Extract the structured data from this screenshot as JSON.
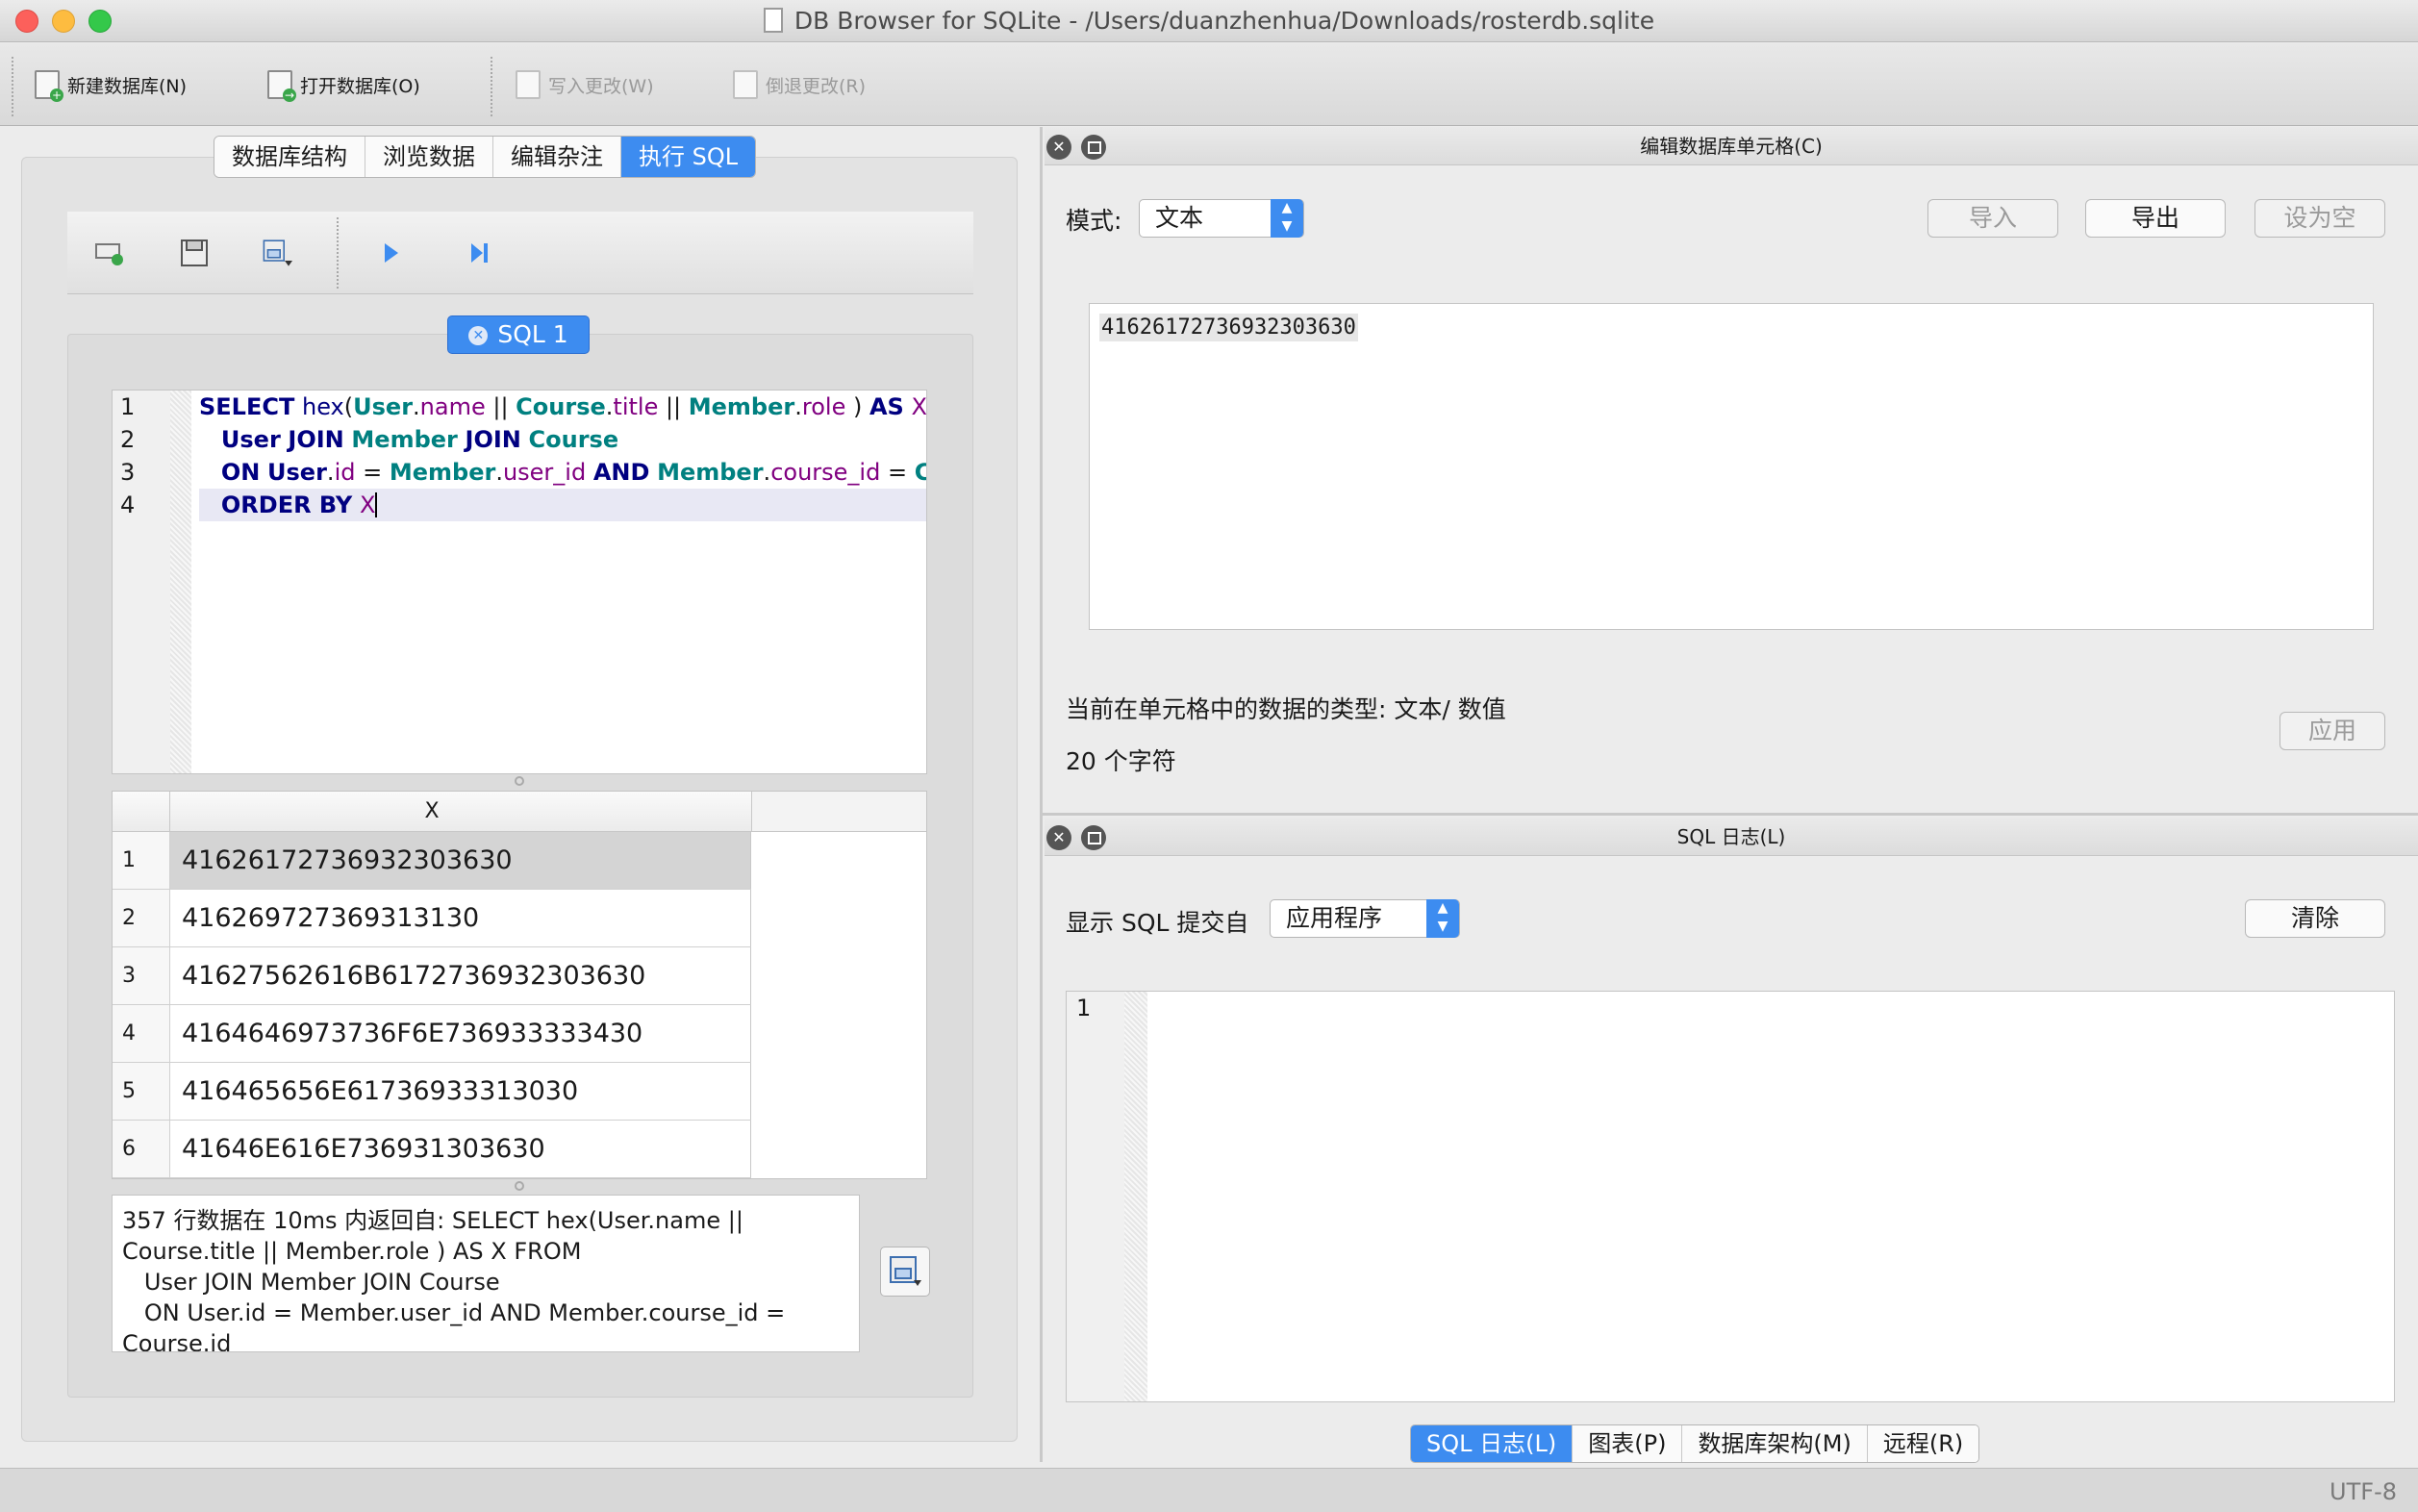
{
  "window": {
    "title": "DB Browser for SQLite - /Users/duanzhenhua/Downloads/rosterdb.sqlite"
  },
  "toolbar": {
    "new_db": "新建数据库(N)",
    "open_db": "打开数据库(O)",
    "write_changes": "写入更改(W)",
    "revert_changes": "倒退更改(R)"
  },
  "main_tabs": [
    "数据库结构",
    "浏览数据",
    "编辑杂注",
    "执行 SQL"
  ],
  "main_tab_active": "执行 SQL",
  "sql_tab": {
    "label": "SQL 1"
  },
  "editor": {
    "line_numbers": [
      "1",
      "2",
      "3",
      "4"
    ]
  },
  "results": {
    "column_header": "X",
    "rows": [
      {
        "idx": "1",
        "value": "41626172736932303630"
      },
      {
        "idx": "2",
        "value": "416269727369313130"
      },
      {
        "idx": "3",
        "value": "41627562616B6172736932303630"
      },
      {
        "idx": "4",
        "value": "4164646973736F6E736933333430"
      },
      {
        "idx": "5",
        "value": "416465656E61736933313030"
      },
      {
        "idx": "6",
        "value": "41646E616E736931303630"
      }
    ]
  },
  "message": {
    "text": "357 行数据在 10ms 内返回自: SELECT hex(User.name || \nCourse.title || Member.role ) AS X FROM \n   User JOIN Member JOIN Course\n   ON User.id = Member.user_id AND Member.course_id = \nCourse.id"
  },
  "cell_panel": {
    "title": "编辑数据库单元格(C)",
    "mode_label": "模式:",
    "mode_value": "文本",
    "import": "导入",
    "export": "导出",
    "set_null": "设为空",
    "cell_value": "41626172736932303630",
    "type_info": "当前在单元格中的数据的类型: 文本/ 数值",
    "char_count": "20 个字符",
    "apply": "应用"
  },
  "log_panel": {
    "title": "SQL 日志(L)",
    "show_label": "显示 SQL 提交自",
    "source_value": "应用程序",
    "clear": "清除",
    "line_number": "1"
  },
  "bottom_tabs": [
    "SQL 日志(L)",
    "图表(P)",
    "数据库架构(M)",
    "远程(R)"
  ],
  "status": {
    "encoding": "UTF-8"
  },
  "colors": {
    "accent": "#3d8cf0",
    "close": "#fc605b",
    "minimize": "#fdbc40",
    "maximize": "#34c84a"
  }
}
